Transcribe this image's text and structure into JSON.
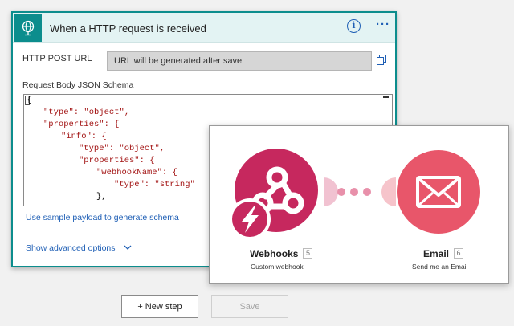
{
  "trigger_card": {
    "title": "When a HTTP request is received",
    "icon": "globe-icon",
    "info_icon": "info-icon",
    "more_icon": "more-icon",
    "http_post_url": {
      "label": "HTTP POST URL",
      "value": "URL will be generated after save",
      "copy_icon": "copy-icon"
    },
    "schema": {
      "label": "Request Body JSON Schema",
      "lines": [
        "{",
        "\"type\": \"object\",",
        "\"properties\": {",
        "\"info\": {",
        "\"type\": \"object\",",
        "\"properties\": {",
        "\"webhookName\": {",
        "\"type\": \"string\"",
        "},"
      ]
    },
    "sample_payload_link": "Use sample payload to generate schema",
    "advanced_options_link": "Show advanced options"
  },
  "buttons": {
    "new_step": "+ New step",
    "save": "Save"
  },
  "scenario": {
    "modules": [
      {
        "name": "Webhooks",
        "badge": "5",
        "subtitle": "Custom webhook",
        "icon": "webhook-icon",
        "trigger_icon": "instant-trigger-icon",
        "color": "#c6285e"
      },
      {
        "name": "Email",
        "badge": "6",
        "subtitle": "Send me an Email",
        "icon": "envelope-icon",
        "color": "#e8566a"
      }
    ],
    "connector_colors": {
      "left": "#f1c2d1",
      "dots": "#e890aa",
      "right": "#f6c4cb"
    }
  },
  "colors": {
    "accent_teal": "#0c8d8d",
    "link_blue": "#1f5fb5",
    "json_key": "#a31515",
    "json_string": "#0451a5"
  }
}
